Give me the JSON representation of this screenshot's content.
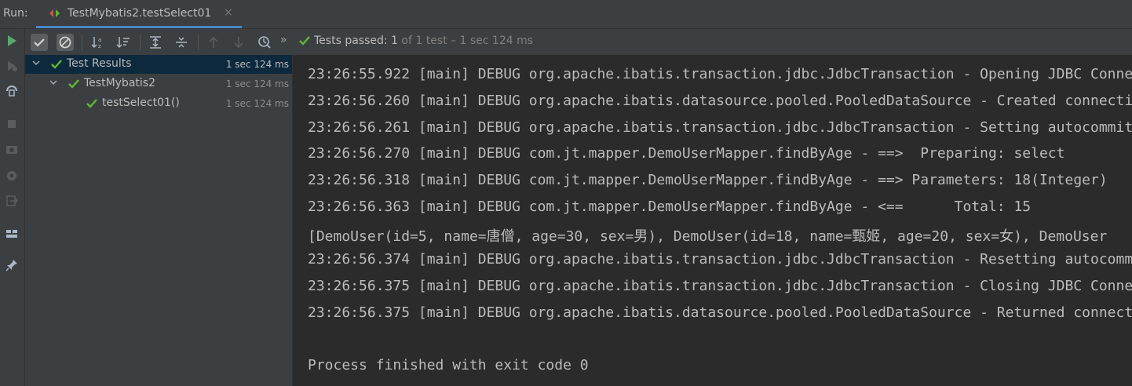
{
  "window": {
    "run_label": "Run:",
    "tab_title": "TestMybatis2.testSelect01",
    "tab_close": "×"
  },
  "toolbar": {
    "status_label": "Tests passed:",
    "status_count": "1",
    "status_detail": "of 1 test – 1 sec 124 ms",
    "more": "»",
    "icons": [
      "run-icon",
      "show-passed-icon",
      "show-ignored-icon",
      "sort-alphabetically-icon",
      "sort-by-duration-icon",
      "expand-all-icon",
      "collapse-all-icon",
      "previous-failed-icon",
      "next-failed-icon",
      "test-history-icon"
    ]
  },
  "tree": {
    "rows": [
      {
        "label": "Test Results",
        "time": "1 sec 124 ms"
      },
      {
        "label": "TestMybatis2",
        "time": "1 sec 124 ms"
      },
      {
        "label": "testSelect01()",
        "time": "1 sec 124 ms"
      }
    ]
  },
  "console": {
    "lines": [
      "23:26:55.922 [main] DEBUG org.apache.ibatis.transaction.jdbc.JdbcTransaction - Opening JDBC Connection",
      "23:26:56.260 [main] DEBUG org.apache.ibatis.datasource.pooled.PooledDataSource - Created connection",
      "23:26:56.261 [main] DEBUG org.apache.ibatis.transaction.jdbc.JdbcTransaction - Setting autocommit",
      "23:26:56.270 [main] DEBUG com.jt.mapper.DemoUserMapper.findByAge - ==>  Preparing: select",
      "23:26:56.318 [main] DEBUG com.jt.mapper.DemoUserMapper.findByAge - ==> Parameters: 18(Integer)",
      "23:26:56.363 [main] DEBUG com.jt.mapper.DemoUserMapper.findByAge - <==      Total: 15",
      "[DemoUser(id=5, name=唐僧, age=30, sex=男), DemoUser(id=18, name=甄姬, age=20, sex=女), DemoUser",
      "23:26:56.374 [main] DEBUG org.apache.ibatis.transaction.jdbc.JdbcTransaction - Resetting autocommit",
      "23:26:56.375 [main] DEBUG org.apache.ibatis.transaction.jdbc.JdbcTransaction - Closing JDBC Connection",
      "23:26:56.375 [main] DEBUG org.apache.ibatis.datasource.pooled.PooledDataSource - Returned connection",
      "",
      "Process finished with exit code 0"
    ]
  },
  "sidebar": {
    "icons": [
      "rerun-icon",
      "rerun-failed-icon",
      "toggle-auto-test-icon",
      "stop-icon",
      "dump-threads-icon",
      "settings-icon",
      "exit-icon",
      "restore-layout-icon",
      "pin-tab-icon"
    ]
  },
  "colors": {
    "background": "#2b2b2b",
    "panel": "#3c3f41",
    "selection": "#0d293e",
    "pass_green": "#5fb832",
    "accent": "#4a88c7"
  }
}
